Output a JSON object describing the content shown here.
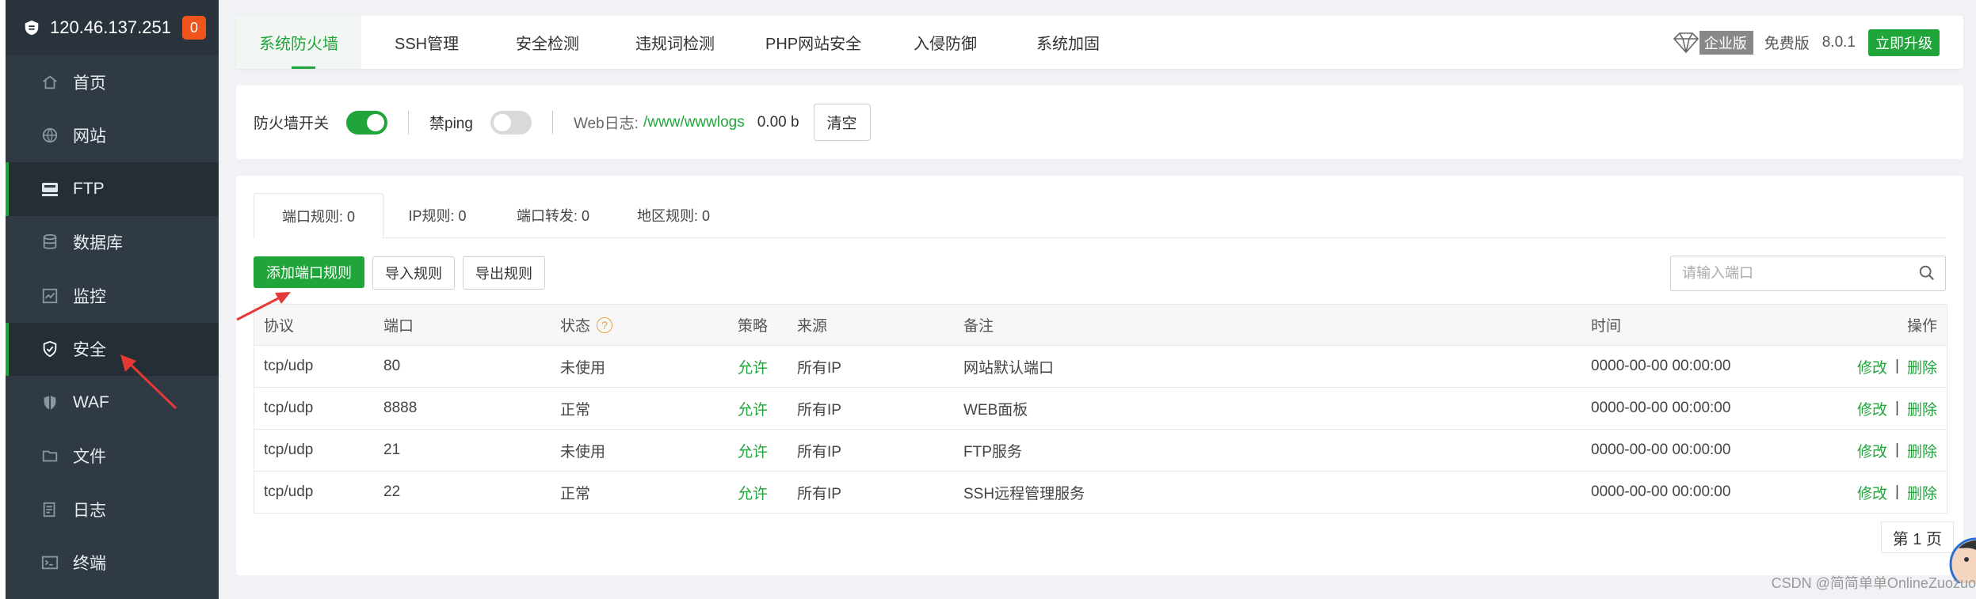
{
  "server": {
    "ip": "120.46.137.251",
    "badge": "0"
  },
  "sidebar": {
    "items": [
      {
        "label": "首页",
        "icon": "home-icon"
      },
      {
        "label": "网站",
        "icon": "globe-icon"
      },
      {
        "label": "FTP",
        "icon": "ftp-icon",
        "active": true
      },
      {
        "label": "数据库",
        "icon": "database-icon"
      },
      {
        "label": "监控",
        "icon": "monitor-icon"
      },
      {
        "label": "安全",
        "icon": "shield-check-icon",
        "active": true
      },
      {
        "label": "WAF",
        "icon": "waf-shield-icon"
      },
      {
        "label": "文件",
        "icon": "folder-icon"
      },
      {
        "label": "日志",
        "icon": "log-icon"
      },
      {
        "label": "终端",
        "icon": "terminal-icon"
      }
    ]
  },
  "tabs": [
    "系统防火墙",
    "SSH管理",
    "安全检测",
    "违规词检测",
    "PHP网站安全",
    "入侵防御",
    "系统加固"
  ],
  "version": {
    "enterprise": "企业版",
    "free": "免费版",
    "number": "8.0.1",
    "upgrade": "立即升级"
  },
  "firewall": {
    "switch_label": "防火墙开关",
    "switch_on": true,
    "ping_label": "禁ping",
    "ping_on": false,
    "weblog_label": "Web日志:",
    "weblog_path": "/www/wwwlogs",
    "weblog_size": "0.00 b",
    "clear_label": "清空"
  },
  "subtabs": [
    "端口规则: 0",
    "IP规则: 0",
    "端口转发: 0",
    "地区规则: 0"
  ],
  "actions": {
    "add": "添加端口规则",
    "import": "导入规则",
    "export": "导出规则",
    "search_placeholder": "请输入端口"
  },
  "table": {
    "headers": [
      "协议",
      "端口",
      "状态",
      "策略",
      "来源",
      "备注",
      "时间",
      "操作"
    ],
    "rows": [
      {
        "protocol": "tcp/udp",
        "port": "80",
        "status": "未使用",
        "policy": "允许",
        "source": "所有IP",
        "note": "网站默认端口",
        "time": "0000-00-00 00:00:00",
        "edit": "修改",
        "delete": "删除"
      },
      {
        "protocol": "tcp/udp",
        "port": "8888",
        "status": "正常",
        "policy": "允许",
        "source": "所有IP",
        "note": "WEB面板",
        "time": "0000-00-00 00:00:00",
        "edit": "修改",
        "delete": "删除"
      },
      {
        "protocol": "tcp/udp",
        "port": "21",
        "status": "未使用",
        "policy": "允许",
        "source": "所有IP",
        "note": "FTP服务",
        "time": "0000-00-00 00:00:00",
        "edit": "修改",
        "delete": "删除"
      },
      {
        "protocol": "tcp/udp",
        "port": "22",
        "status": "正常",
        "policy": "允许",
        "source": "所有IP",
        "note": "SSH远程管理服务",
        "time": "0000-00-00 00:00:00",
        "edit": "修改",
        "delete": "删除"
      }
    ]
  },
  "pager": "第 1 页",
  "watermark": "CSDN @简简单单OnlineZuozuo",
  "colors": {
    "accent": "#20a53a",
    "sidebar": "#303a44",
    "badge": "#f0541e",
    "annotation": "#e53935"
  }
}
